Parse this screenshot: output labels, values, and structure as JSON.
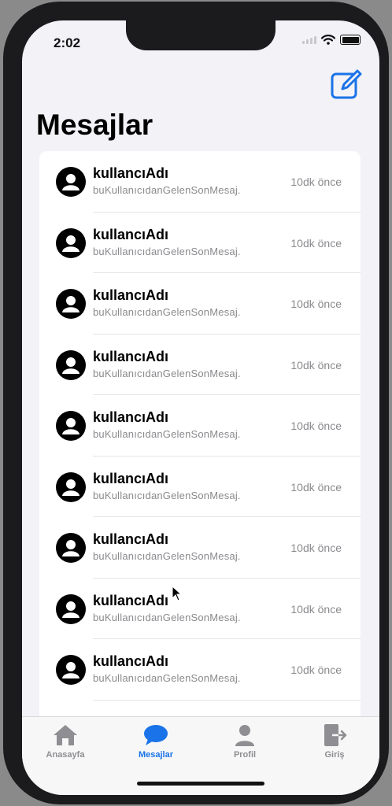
{
  "status_bar": {
    "time": "2:02"
  },
  "header": {
    "title": "Mesajlar",
    "compose_icon": "compose-icon",
    "accent": "#1a73e8"
  },
  "messages": [
    {
      "name": "kullancıAdı",
      "message": "buKullanıcıdanGelenSonMesaj.",
      "time": "10dk önce"
    },
    {
      "name": "kullancıAdı",
      "message": "buKullanıcıdanGelenSonMesaj.",
      "time": "10dk önce"
    },
    {
      "name": "kullancıAdı",
      "message": "buKullanıcıdanGelenSonMesaj.",
      "time": "10dk önce"
    },
    {
      "name": "kullancıAdı",
      "message": "buKullanıcıdanGelenSonMesaj.",
      "time": "10dk önce"
    },
    {
      "name": "kullancıAdı",
      "message": "buKullanıcıdanGelenSonMesaj.",
      "time": "10dk önce"
    },
    {
      "name": "kullancıAdı",
      "message": "buKullanıcıdanGelenSonMesaj.",
      "time": "10dk önce"
    },
    {
      "name": "kullancıAdı",
      "message": "buKullanıcıdanGelenSonMesaj.",
      "time": "10dk önce"
    },
    {
      "name": "kullancıAdı",
      "message": "buKullanıcıdanGelenSonMesaj.",
      "time": "10dk önce"
    },
    {
      "name": "kullancıAdı",
      "message": "buKullanıcıdanGelenSonMesaj.",
      "time": "10dk önce"
    }
  ],
  "tabs": [
    {
      "label": "Anasayfa",
      "icon": "house-icon",
      "active": false
    },
    {
      "label": "Mesajlar",
      "icon": "chat-bubble-icon",
      "active": true
    },
    {
      "label": "Profil",
      "icon": "person-icon",
      "active": false
    },
    {
      "label": "Giriş",
      "icon": "door-exit-icon",
      "active": false
    }
  ]
}
